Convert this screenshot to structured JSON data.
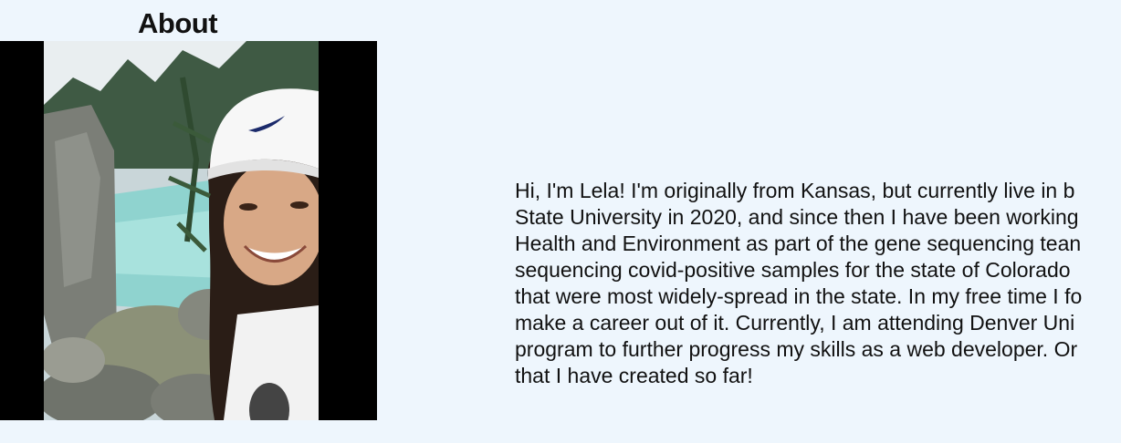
{
  "section": {
    "title": "About"
  },
  "photo": {
    "alt": "Lela smiling near an alpine lake",
    "icon": "portrait-photo"
  },
  "bio": {
    "lines": [
      "Hi, I'm Lela! I'm originally from Kansas, but currently live in b",
      "State University in 2020, and since then I have been working",
      "Health and Environment as part of the gene sequencing tean",
      "sequencing covid-positive samples for the state of Colorado",
      "that were most widely-spread in the state. In my free time I fo",
      "make a career out of it. Currently, I am attending Denver Uni",
      "program to further progress my skills as a web developer. Or",
      "that I have created so far!"
    ]
  }
}
